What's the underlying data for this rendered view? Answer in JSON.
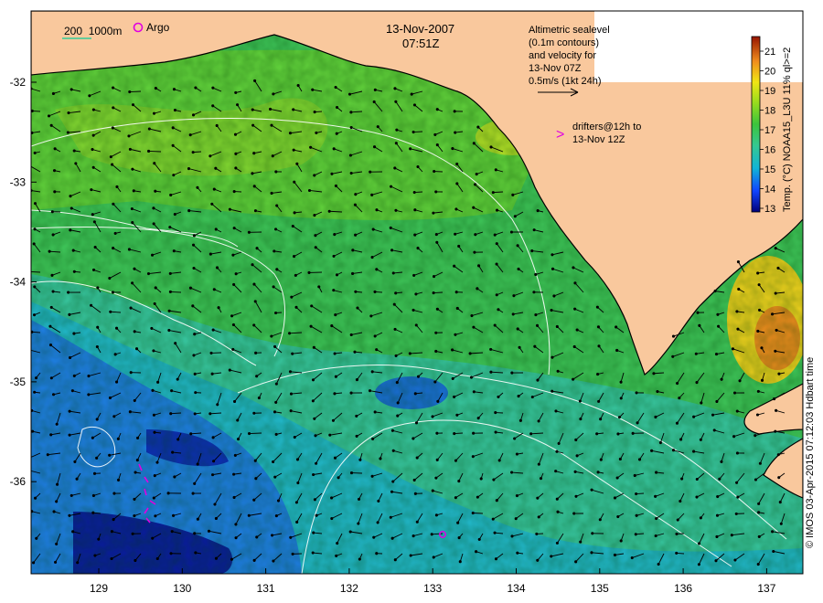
{
  "map": {
    "date": "13-Nov-2007",
    "time": "07:51Z",
    "bathymetry_legend": "200  1000m",
    "argo_legend": "Argo",
    "altimetry_lines": [
      "Altimetric sealevel",
      "(0.1m contours)",
      "and velocity for",
      "13-Nov 07Z",
      "0.5m/s (1kt 24h)"
    ],
    "drifter_lines": [
      "drifters@12h to",
      "13-Nov 12Z"
    ],
    "drifter_symbol": ">",
    "credit": "© IMOS 03-Apr-2015 07:12:03 Hdbart time",
    "colorbar": {
      "title": "Temp. (°C) NOAA15_L3U 11% ql>=2",
      "ticks": [
        "13",
        "14",
        "15",
        "16",
        "17",
        "18",
        "19",
        "20",
        "21"
      ]
    },
    "lon_ticks": [
      "129",
      "130",
      "131",
      "132",
      "133",
      "134",
      "135",
      "136",
      "137"
    ],
    "lat_ticks": [
      "-32",
      "-33",
      "-34",
      "-35",
      "-36"
    ],
    "colors": {
      "land": "#f9c89d",
      "argo": "#e000e0",
      "contour": "#ffffff"
    }
  }
}
